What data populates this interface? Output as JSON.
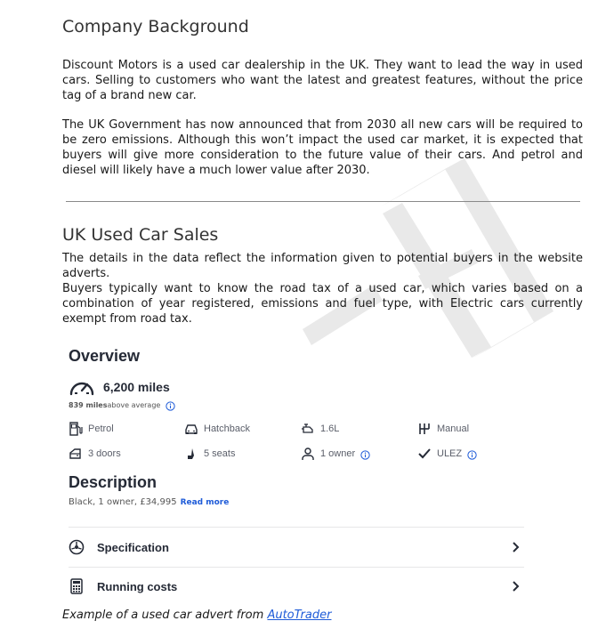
{
  "company": {
    "heading": "Company Background",
    "para1": "Discount Motors is a used car dealership in the UK. They want to lead the way in used cars. Selling to customers who want the latest and greatest features, without the price tag of a brand new car.",
    "para2": "The UK Government has now announced that from 2030 all new cars will be required to be zero emissions. Although this won’t impact the used car market, it is expected that buyers will give more consideration to the future value of their cars. And petrol and diesel will likely have a much lower value after 2030."
  },
  "sales": {
    "heading": "UK Used Car Sales",
    "para1": "The details in the data reflect the information given to potential buyers in the website adverts.",
    "para2": "Buyers typically want to know the road tax of a used car, which varies based on a combination of year registered, emissions and fuel type, with Electric cars currently exempt from road tax."
  },
  "advert": {
    "overview_title": "Overview",
    "mileage": "6,200 miles",
    "avg_bold": "839 miles",
    "avg_rest": "above average",
    "specs": {
      "fuel": "Petrol",
      "body": "Hatchback",
      "engine": "1.6L",
      "gearbox": "Manual",
      "doors": "3 doors",
      "seats": "5 seats",
      "owners": "1 owner",
      "ulez": "ULEZ"
    },
    "description_title": "Description",
    "description_text": "Black, 1 owner, £34,995",
    "read_more": "Read more",
    "specification_label": "Specification",
    "running_costs_label": "Running costs"
  },
  "caption": {
    "text": "Example of a used car advert from ",
    "link": "AutoTrader"
  },
  "colors": {
    "accent_blue": "#1e5bd8",
    "watermark": "#ececec"
  }
}
